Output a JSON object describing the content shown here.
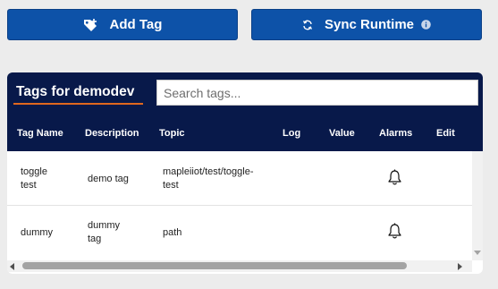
{
  "toolbar": {
    "add_tag_label": "Add Tag",
    "sync_runtime_label": "Sync Runtime"
  },
  "panel": {
    "title": "Tags for demodev",
    "search_placeholder": "Search tags...",
    "columns": [
      "Tag Name",
      "Description",
      "Topic",
      "Log",
      "Value",
      "Alarms",
      "Edit"
    ],
    "rows": [
      {
        "name_line1": "toggle",
        "name_line2": "test",
        "desc_line1": "demo tag",
        "desc_line2": "",
        "topic_line1": "mapleiiot/test/toggle-",
        "topic_line2": "test",
        "log": "",
        "value": ""
      },
      {
        "name_line1": "dummy",
        "name_line2": "",
        "desc_line1": "dummy",
        "desc_line2": "tag",
        "topic_line1": "path",
        "topic_line2": "",
        "log": "",
        "value": ""
      }
    ]
  },
  "icons": {
    "add_tag": "tag-plus-icon",
    "sync": "sync-icon",
    "info": "info-icon",
    "alarm": "bell-icon"
  },
  "colors": {
    "button_bg": "#0d52a8",
    "header_bg": "#08194a",
    "title_underline": "#e0671e",
    "page_bg": "#ececec"
  }
}
